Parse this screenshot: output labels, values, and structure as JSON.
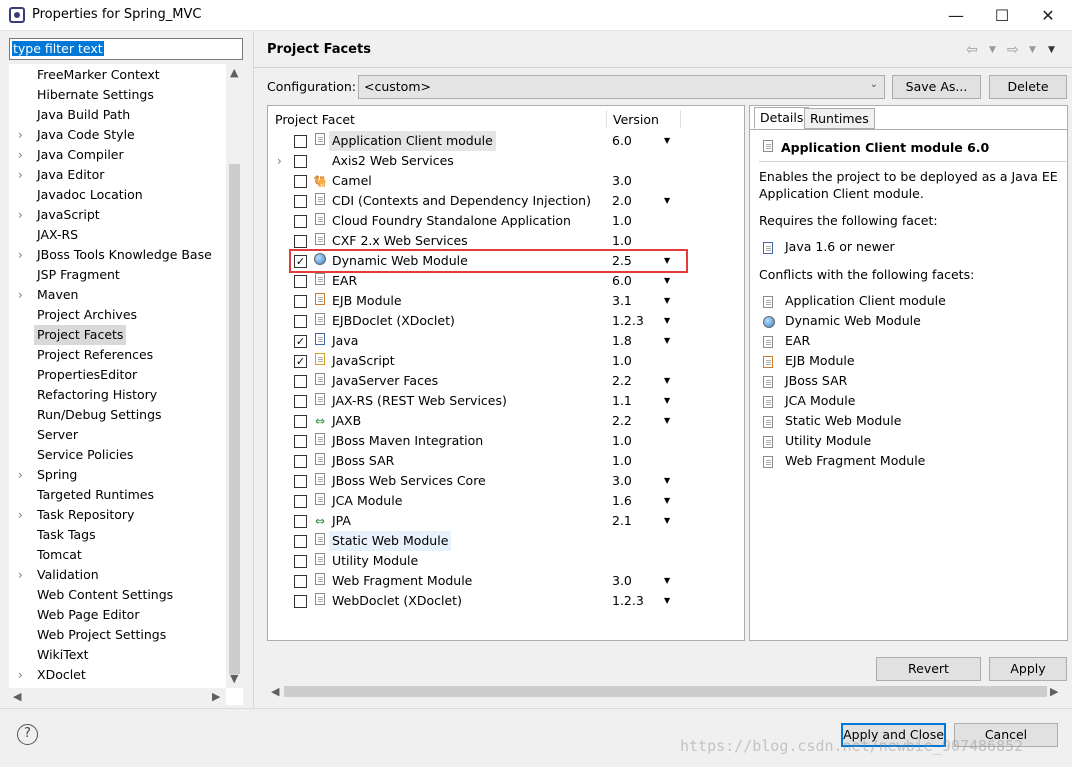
{
  "window": {
    "title": "Properties for Spring_MVC",
    "minimize": "—",
    "maximize": "☐",
    "close": "✕"
  },
  "filter": {
    "value": "type filter text"
  },
  "nav": {
    "items": [
      {
        "label": "FreeMarker Context",
        "expandable": false,
        "selected": false
      },
      {
        "label": "Hibernate Settings",
        "expandable": false,
        "selected": false
      },
      {
        "label": "Java Build Path",
        "expandable": false,
        "selected": false
      },
      {
        "label": "Java Code Style",
        "expandable": true,
        "selected": false
      },
      {
        "label": "Java Compiler",
        "expandable": true,
        "selected": false
      },
      {
        "label": "Java Editor",
        "expandable": true,
        "selected": false
      },
      {
        "label": "Javadoc Location",
        "expandable": false,
        "selected": false
      },
      {
        "label": "JavaScript",
        "expandable": true,
        "selected": false
      },
      {
        "label": "JAX-RS",
        "expandable": false,
        "selected": false
      },
      {
        "label": "JBoss Tools Knowledge Base",
        "expandable": true,
        "selected": false
      },
      {
        "label": "JSP Fragment",
        "expandable": false,
        "selected": false
      },
      {
        "label": "Maven",
        "expandable": true,
        "selected": false
      },
      {
        "label": "Project Archives",
        "expandable": false,
        "selected": false
      },
      {
        "label": "Project Facets",
        "expandable": false,
        "selected": true
      },
      {
        "label": "Project References",
        "expandable": false,
        "selected": false
      },
      {
        "label": "PropertiesEditor",
        "expandable": false,
        "selected": false
      },
      {
        "label": "Refactoring History",
        "expandable": false,
        "selected": false
      },
      {
        "label": "Run/Debug Settings",
        "expandable": false,
        "selected": false
      },
      {
        "label": "Server",
        "expandable": false,
        "selected": false
      },
      {
        "label": "Service Policies",
        "expandable": false,
        "selected": false
      },
      {
        "label": "Spring",
        "expandable": true,
        "selected": false
      },
      {
        "label": "Targeted Runtimes",
        "expandable": false,
        "selected": false
      },
      {
        "label": "Task Repository",
        "expandable": true,
        "selected": false
      },
      {
        "label": "Task Tags",
        "expandable": false,
        "selected": false
      },
      {
        "label": "Tomcat",
        "expandable": false,
        "selected": false
      },
      {
        "label": "Validation",
        "expandable": true,
        "selected": false
      },
      {
        "label": "Web Content Settings",
        "expandable": false,
        "selected": false
      },
      {
        "label": "Web Page Editor",
        "expandable": false,
        "selected": false
      },
      {
        "label": "Web Project Settings",
        "expandable": false,
        "selected": false
      },
      {
        "label": "WikiText",
        "expandable": false,
        "selected": false
      },
      {
        "label": "XDoclet",
        "expandable": true,
        "selected": false
      }
    ]
  },
  "page": {
    "title": "Project Facets",
    "config_label": "Configuration:",
    "config_value": "<custom>",
    "save_as": "Save As...",
    "delete": "Delete",
    "col_facet": "Project Facet",
    "col_version": "Version"
  },
  "facets": [
    {
      "name": "Application Client module",
      "version": "6.0",
      "checked": false,
      "dropdown": true,
      "expander": false,
      "icon": "doc-icon",
      "hl": "hl"
    },
    {
      "name": "Axis2 Web Services",
      "version": "",
      "checked": false,
      "dropdown": false,
      "expander": true,
      "icon": "none",
      "hl": ""
    },
    {
      "name": "Camel",
      "version": "3.0",
      "checked": false,
      "dropdown": false,
      "expander": false,
      "icon": "camel-icon",
      "hl": ""
    },
    {
      "name": "CDI (Contexts and Dependency Injection)",
      "version": "2.0",
      "checked": false,
      "dropdown": true,
      "expander": false,
      "icon": "doc-icon",
      "hl": ""
    },
    {
      "name": "Cloud Foundry Standalone Application",
      "version": "1.0",
      "checked": false,
      "dropdown": false,
      "expander": false,
      "icon": "doc-icon",
      "hl": ""
    },
    {
      "name": "CXF 2.x Web Services",
      "version": "1.0",
      "checked": false,
      "dropdown": false,
      "expander": false,
      "icon": "doc-icon",
      "hl": ""
    },
    {
      "name": "Dynamic Web Module",
      "version": "2.5",
      "checked": true,
      "dropdown": true,
      "expander": false,
      "icon": "globe-icon",
      "hl": ""
    },
    {
      "name": "EAR",
      "version": "6.0",
      "checked": false,
      "dropdown": true,
      "expander": false,
      "icon": "doc-icon",
      "hl": ""
    },
    {
      "name": "EJB Module",
      "version": "3.1",
      "checked": false,
      "dropdown": true,
      "expander": false,
      "icon": "ejb-icon",
      "hl": ""
    },
    {
      "name": "EJBDoclet (XDoclet)",
      "version": "1.2.3",
      "checked": false,
      "dropdown": true,
      "expander": false,
      "icon": "doc-icon",
      "hl": ""
    },
    {
      "name": "Java",
      "version": "1.8",
      "checked": true,
      "dropdown": true,
      "expander": false,
      "icon": "java-icon",
      "hl": ""
    },
    {
      "name": "JavaScript",
      "version": "1.0",
      "checked": true,
      "dropdown": false,
      "expander": false,
      "icon": "js-icon",
      "hl": ""
    },
    {
      "name": "JavaServer Faces",
      "version": "2.2",
      "checked": false,
      "dropdown": true,
      "expander": false,
      "icon": "doc-icon",
      "hl": ""
    },
    {
      "name": "JAX-RS (REST Web Services)",
      "version": "1.1",
      "checked": false,
      "dropdown": true,
      "expander": false,
      "icon": "doc-icon",
      "hl": ""
    },
    {
      "name": "JAXB",
      "version": "2.2",
      "checked": false,
      "dropdown": true,
      "expander": false,
      "icon": "arrows-icon",
      "hl": ""
    },
    {
      "name": "JBoss Maven Integration",
      "version": "1.0",
      "checked": false,
      "dropdown": false,
      "expander": false,
      "icon": "doc-icon",
      "hl": ""
    },
    {
      "name": "JBoss SAR",
      "version": "1.0",
      "checked": false,
      "dropdown": false,
      "expander": false,
      "icon": "doc-icon",
      "hl": ""
    },
    {
      "name": "JBoss Web Services Core",
      "version": "3.0",
      "checked": false,
      "dropdown": true,
      "expander": false,
      "icon": "doc-icon",
      "hl": ""
    },
    {
      "name": "JCA Module",
      "version": "1.6",
      "checked": false,
      "dropdown": true,
      "expander": false,
      "icon": "doc-icon",
      "hl": ""
    },
    {
      "name": "JPA",
      "version": "2.1",
      "checked": false,
      "dropdown": true,
      "expander": false,
      "icon": "arrows-icon",
      "hl": ""
    },
    {
      "name": "Static Web Module",
      "version": "",
      "checked": false,
      "dropdown": false,
      "expander": false,
      "icon": "doc-icon",
      "hl": "hl2"
    },
    {
      "name": "Utility Module",
      "version": "",
      "checked": false,
      "dropdown": false,
      "expander": false,
      "icon": "doc-icon",
      "hl": ""
    },
    {
      "name": "Web Fragment Module",
      "version": "3.0",
      "checked": false,
      "dropdown": true,
      "expander": false,
      "icon": "doc-icon",
      "hl": ""
    },
    {
      "name": "WebDoclet (XDoclet)",
      "version": "1.2.3",
      "checked": false,
      "dropdown": true,
      "expander": false,
      "icon": "doc-icon",
      "hl": ""
    }
  ],
  "details": {
    "tab_details": "Details",
    "tab_runtimes": "Runtimes",
    "heading": "Application Client module 6.0",
    "desc_line1": "Enables the project to be deployed as a Java EE",
    "desc_line2": "Application Client module.",
    "requires_label": "Requires the following facet:",
    "requires": [
      {
        "label": "Java 1.6 or newer",
        "icon": "java-icon"
      }
    ],
    "conflicts_label": "Conflicts with the following facets:",
    "conflicts": [
      {
        "label": "Application Client module",
        "icon": "doc-icon"
      },
      {
        "label": "Dynamic Web Module",
        "icon": "globe-icon"
      },
      {
        "label": "EAR",
        "icon": "doc-icon"
      },
      {
        "label": "EJB Module",
        "icon": "ejb-icon"
      },
      {
        "label": "JBoss SAR",
        "icon": "doc-icon"
      },
      {
        "label": "JCA Module",
        "icon": "doc-icon"
      },
      {
        "label": "Static Web Module",
        "icon": "doc-icon"
      },
      {
        "label": "Utility Module",
        "icon": "doc-icon"
      },
      {
        "label": "Web Fragment Module",
        "icon": "doc-icon"
      }
    ]
  },
  "buttons": {
    "revert": "Revert",
    "apply": "Apply",
    "apply_close": "Apply and Close",
    "cancel": "Cancel",
    "help": "?"
  },
  "watermark": "https://blog.csdn.net/newbie_907486852",
  "colors": {
    "highlight_box": "#e23b3b",
    "selection": "#0078d7"
  }
}
